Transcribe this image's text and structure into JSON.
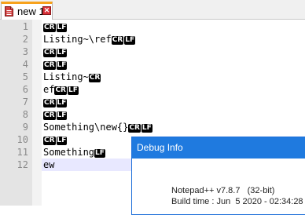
{
  "tab": {
    "label": "new 1",
    "close_glyph": "✕",
    "accent": "#f7a21c"
  },
  "editor": {
    "current_line_bg": "#e8e8ff",
    "lines": [
      {
        "num": "1",
        "text": "",
        "eols": [
          "CR",
          "LF"
        ]
      },
      {
        "num": "2",
        "text": "Listing~\\ref",
        "eols": [
          "CR",
          "LF"
        ]
      },
      {
        "num": "3",
        "text": "",
        "eols": [
          "CR",
          "LF"
        ]
      },
      {
        "num": "4",
        "text": "",
        "eols": [
          "CR",
          "LF"
        ]
      },
      {
        "num": "5",
        "text": "Listing~",
        "eols": [
          "CR"
        ]
      },
      {
        "num": "6",
        "text": "ef",
        "eols": [
          "CR",
          "LF"
        ]
      },
      {
        "num": "7",
        "text": "",
        "eols": [
          "CR",
          "LF"
        ]
      },
      {
        "num": "8",
        "text": "",
        "eols": [
          "CR",
          "LF"
        ]
      },
      {
        "num": "9",
        "text": "Something\\new{}",
        "eols": [
          "CR",
          "LF"
        ]
      },
      {
        "num": "10",
        "text": "",
        "eols": [
          "CR",
          "LF"
        ]
      },
      {
        "num": "11",
        "text": "Something",
        "eols": [
          "LF"
        ]
      },
      {
        "num": "12",
        "text": "ew",
        "eols": []
      }
    ]
  },
  "dialog": {
    "title": "Debug Info",
    "line1": "Notepad++ v7.8.7   (32-bit)",
    "line2": "Build time : Jun  5 2020 - 02:34:28"
  }
}
